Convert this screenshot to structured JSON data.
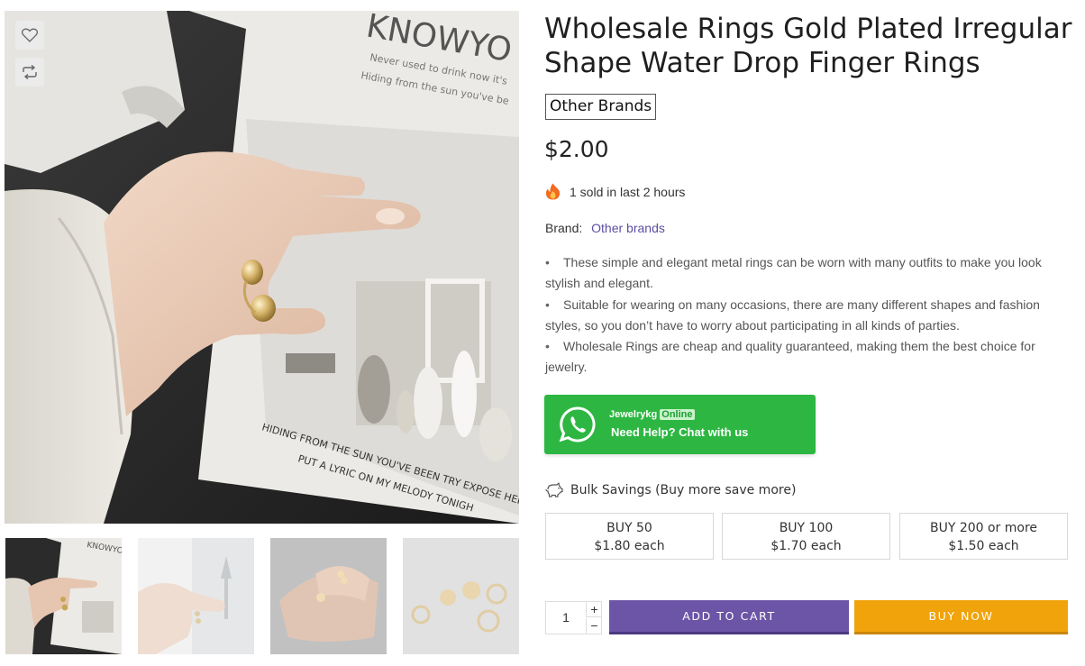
{
  "product": {
    "title": "Wholesale Rings Gold Plated Irregular Shape Water Drop Finger Rings",
    "brand_tag": "Other Brands",
    "price": "$2.00",
    "sold_text": "1 sold in last 2 hours",
    "brand_label": "Brand:",
    "brand_link": "Other brands",
    "bullets": [
      "These simple and elegant metal rings can be worn with many outfits to make you look stylish and elegant.",
      "Suitable for wearing on many occasions, there are many different shapes and fashion styles, so you don’t have to worry about participating in all kinds of parties.",
      "Wholesale Rings are cheap and quality guaranteed, making them the best choice for jewelry."
    ]
  },
  "gallery": {
    "main_text_top": "KNOWYO",
    "main_text_sub1": "Never used to drink now it's",
    "main_text_sub2": "Hiding from the sun you've be",
    "main_text_bottom1": "HIDING FROM THE SUN YOU'VE BEEN TRY EXPOSE HER",
    "main_text_bottom2": "PUT A LYRIC ON MY MELODY TONIGH",
    "thumb_text": "KNOWYO",
    "icons": {
      "wishlist": "heart-icon",
      "compare": "compare-arrows-icon"
    }
  },
  "whatsapp": {
    "agent": "Jewelrykg",
    "status": "Online",
    "cta": "Need Help? Chat with us",
    "icon": "whatsapp-icon",
    "color": "#2db742"
  },
  "bulk": {
    "heading": "Bulk Savings (Buy more save more)",
    "icon": "piggy-bank-icon",
    "tiers": [
      {
        "qty": "BUY 50",
        "price": "$1.80 each"
      },
      {
        "qty": "BUY 100",
        "price": "$1.70 each"
      },
      {
        "qty": "BUY 200 or more",
        "price": "$1.50 each"
      }
    ]
  },
  "purchase": {
    "quantity": "1",
    "plus": "+",
    "minus": "−",
    "add_to_cart": "ADD TO CART",
    "buy_now": "BUY NOW",
    "cart_color": "#6c55a6",
    "buy_color": "#f0a30a"
  }
}
